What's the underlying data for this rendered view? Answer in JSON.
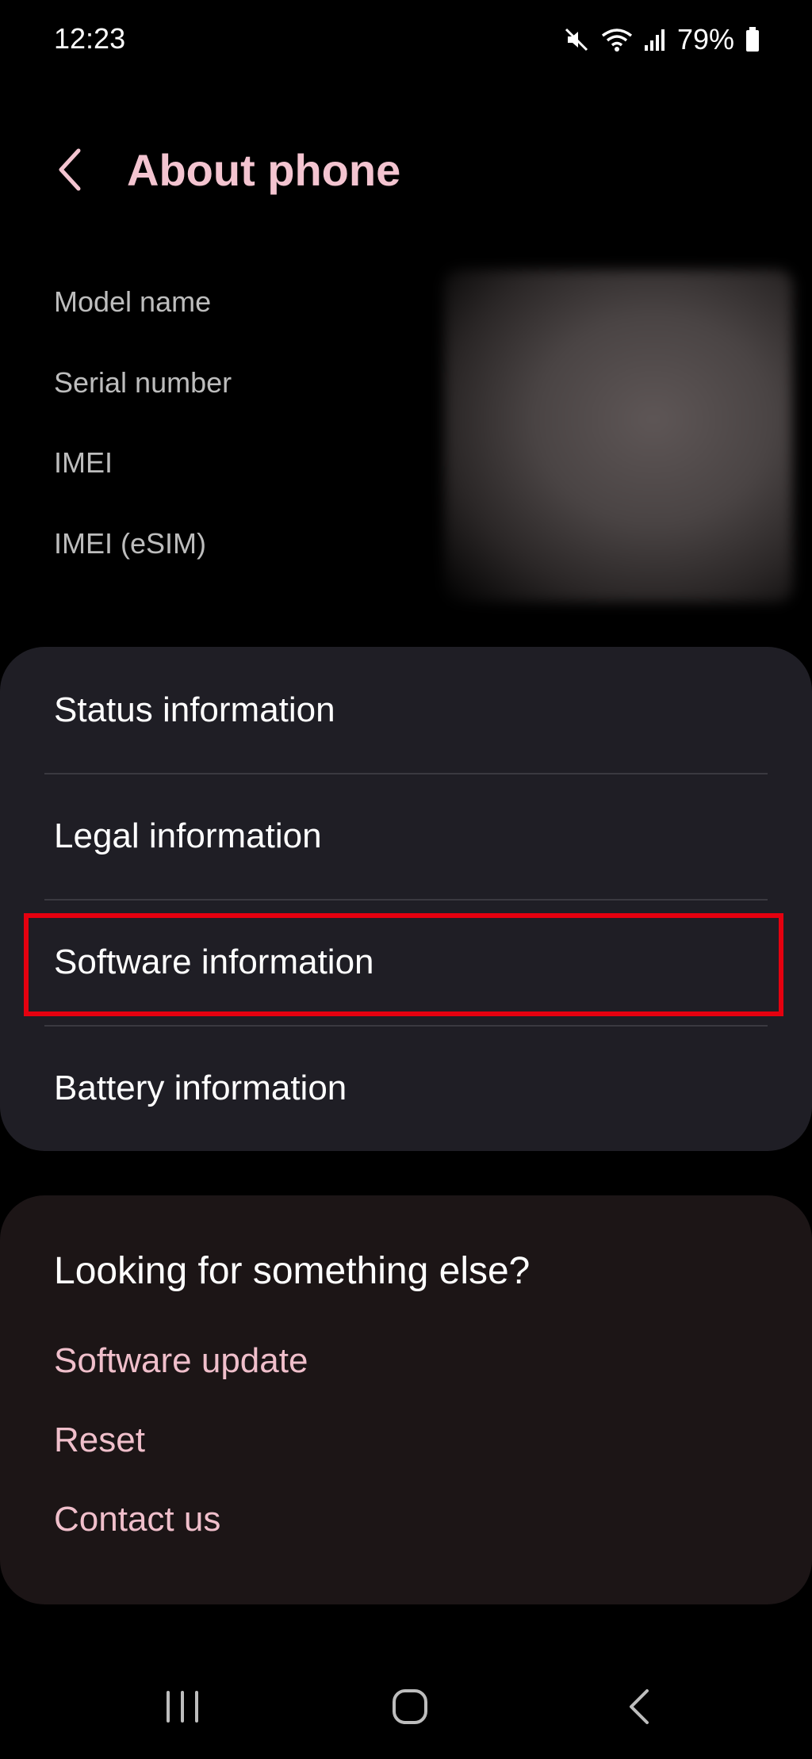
{
  "status_bar": {
    "time": "12:23",
    "battery": "79%",
    "icons": [
      "mute-icon",
      "wifi-icon",
      "signal-icon",
      "battery-icon"
    ]
  },
  "header": {
    "title": "About phone",
    "back_icon": "chevron-left-icon"
  },
  "device_info": {
    "labels": [
      "Model name",
      "Serial number",
      "IMEI",
      "IMEI (eSIM)"
    ]
  },
  "info_menu": {
    "items": [
      {
        "label": "Status information"
      },
      {
        "label": "Legal information"
      },
      {
        "label": "Software information"
      },
      {
        "label": "Battery information"
      }
    ]
  },
  "suggestions": {
    "heading": "Looking for something else?",
    "links": [
      "Software update",
      "Reset",
      "Contact us"
    ]
  },
  "nav_bar": {
    "buttons": [
      "recent-apps-icon",
      "home-icon",
      "back-icon"
    ]
  },
  "colors": {
    "accent": "#f3c4d0",
    "link": "#f0bfcb",
    "highlight": "#e5000f",
    "card_bg": "#1f1e25",
    "suggest_bg": "#1c1516"
  }
}
